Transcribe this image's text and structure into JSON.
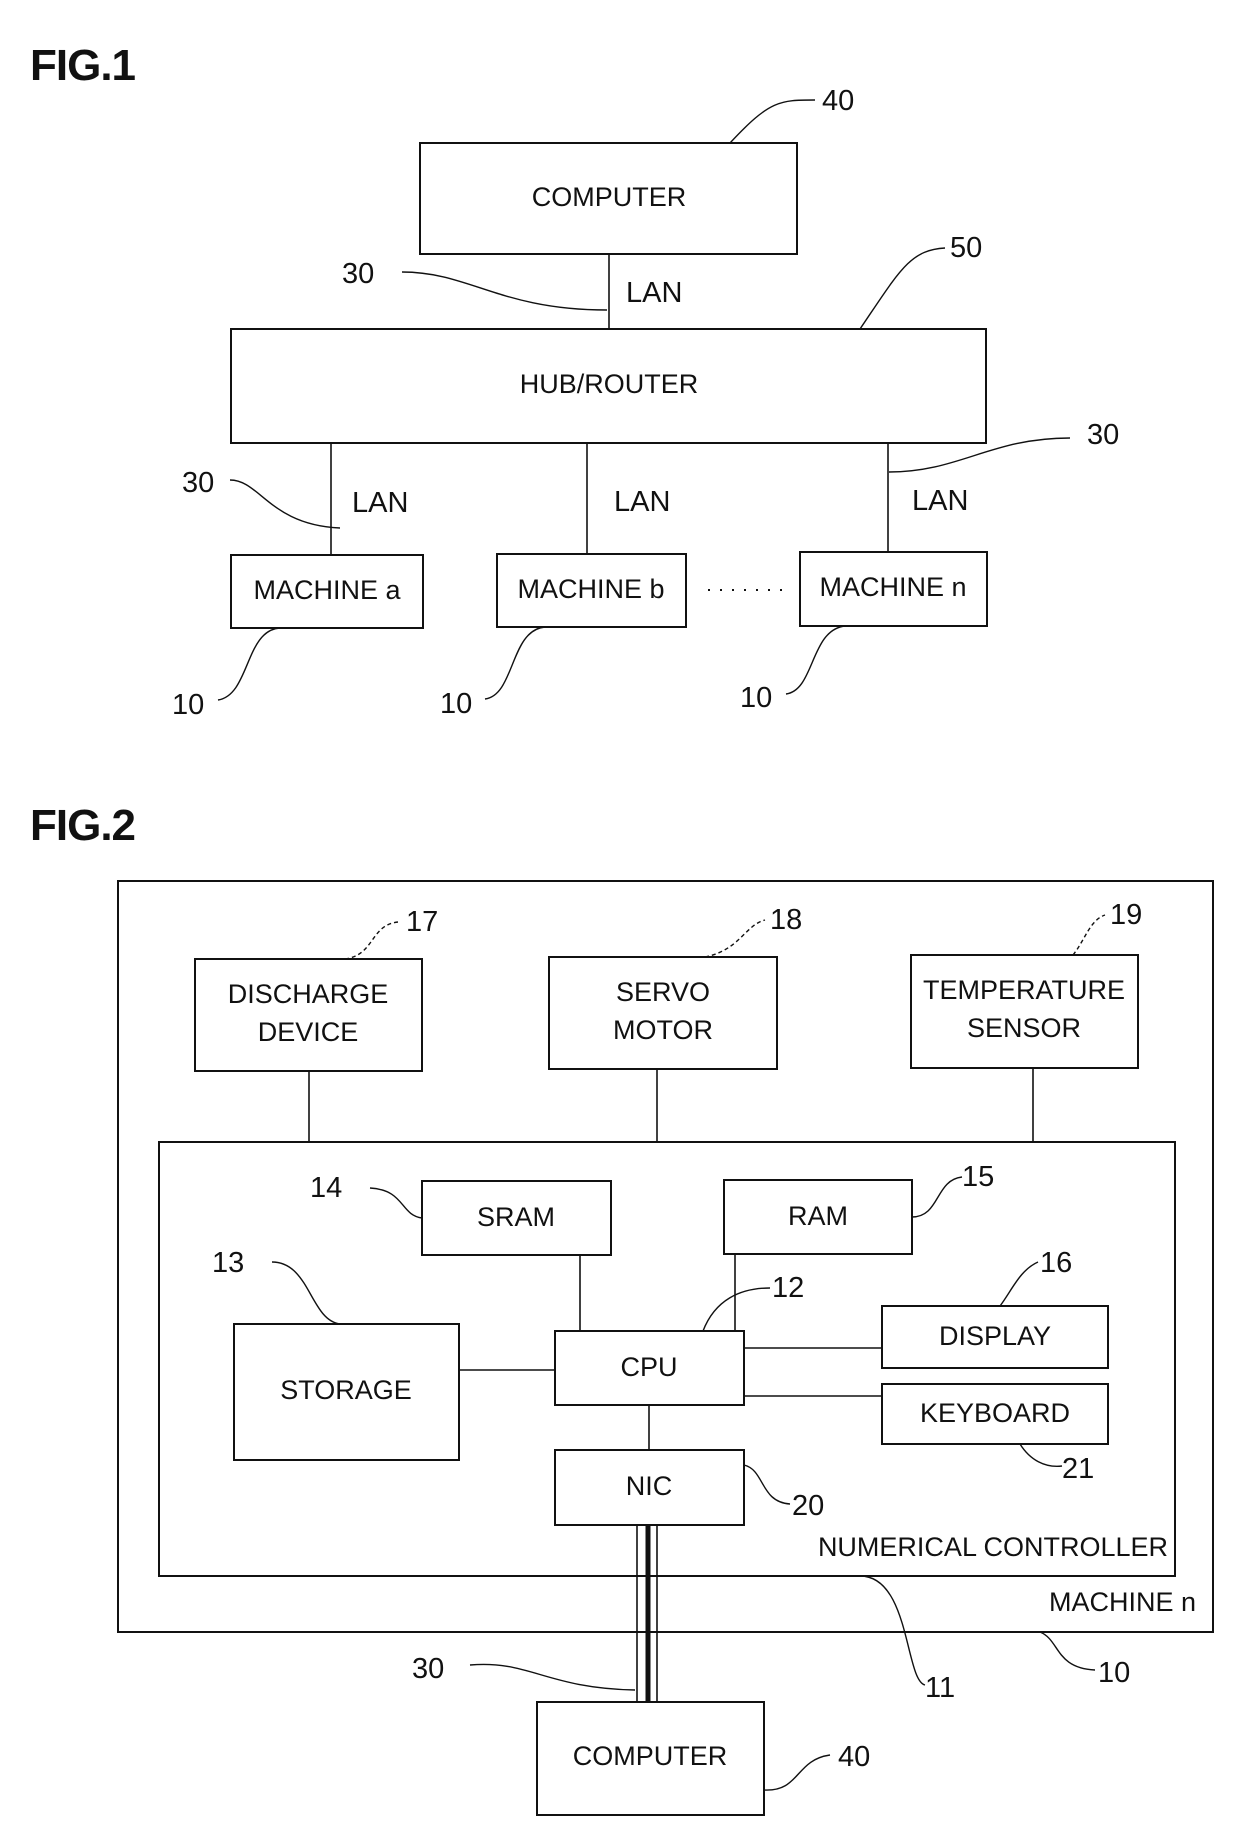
{
  "fig1": {
    "title": "FIG.1",
    "computer": {
      "label": "COMPUTER",
      "ref": "40"
    },
    "hub": {
      "label": "HUB/ROUTER",
      "ref": "50"
    },
    "lan_label": "LAN",
    "lan_ref": "30",
    "machines": [
      {
        "label": "MACHINE a",
        "ref": "10"
      },
      {
        "label": "MACHINE b",
        "ref": "10"
      },
      {
        "label": "MACHINE n",
        "ref": "10"
      }
    ],
    "ellipsis": "· · · · ·"
  },
  "fig2": {
    "title": "FIG.2",
    "machine": {
      "label": "MACHINE n",
      "ref": "10"
    },
    "controller": {
      "label": "NUMERICAL CONTROLLER",
      "ref": "11"
    },
    "discharge": {
      "line1": "DISCHARGE",
      "line2": "DEVICE",
      "ref": "17"
    },
    "servo": {
      "line1": "SERVO",
      "line2": "MOTOR",
      "ref": "18"
    },
    "temperature": {
      "line1": "TEMPERATURE",
      "line2": "SENSOR",
      "ref": "19"
    },
    "sram": {
      "label": "SRAM",
      "ref": "14"
    },
    "ram": {
      "label": "RAM",
      "ref": "15"
    },
    "storage": {
      "label": "STORAGE",
      "ref": "13"
    },
    "cpu": {
      "label": "CPU",
      "ref": "12"
    },
    "display": {
      "label": "DISPLAY",
      "ref": "16"
    },
    "keyboard": {
      "label": "KEYBOARD",
      "ref": "21"
    },
    "nic": {
      "label": "NIC",
      "ref": "20"
    },
    "lan_ref": "30",
    "computer": {
      "label": "COMPUTER",
      "ref": "40"
    }
  }
}
